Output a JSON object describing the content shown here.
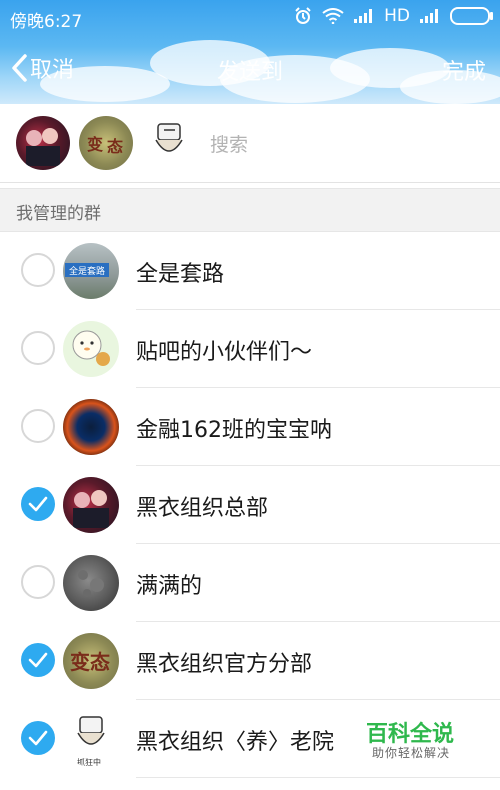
{
  "status_bar": {
    "time": "傍晚6:27",
    "network": "HD"
  },
  "nav": {
    "cancel_label": "取消",
    "title": "发送到",
    "done_label": "完成"
  },
  "selected": {
    "search_placeholder": "搜索",
    "avatars": [
      {
        "name": "黑衣组织总部",
        "icon": "anime-group-avatar"
      },
      {
        "name": "黑衣组织官方分部",
        "icon": "biantai-text-avatar"
      },
      {
        "name": "黑衣组织〈养〉老院",
        "icon": "cartoon-cat-avatar",
        "caption": "抓狂中"
      }
    ]
  },
  "section_header": "我管理的群",
  "groups": [
    {
      "name": "全是套路",
      "checked": false,
      "avatar": "street-sign-avatar",
      "avatar_text": "全是套路"
    },
    {
      "name": "贴吧的小伙伴们～",
      "checked": false,
      "avatar": "cartoon-duck-avatar"
    },
    {
      "name": "金融162班的宝宝呐",
      "checked": false,
      "avatar": "blue-fire-avatar"
    },
    {
      "name": "黑衣组织总部",
      "checked": true,
      "avatar": "anime-group-avatar"
    },
    {
      "name": "满满的",
      "checked": false,
      "avatar": "moon-avatar"
    },
    {
      "name": "黑衣组织官方分部",
      "checked": true,
      "avatar": "biantai-text-avatar",
      "avatar_text": "变态"
    },
    {
      "name": "黑衣组织〈养〉老院",
      "checked": true,
      "avatar": "cartoon-cat-avatar",
      "avatar_text": "抓狂中"
    }
  ],
  "watermark": {
    "title": "百科全说",
    "subtitle": "助你轻松解决"
  },
  "colors": {
    "accent": "#2eaaf0",
    "watermark_green": "#2fb84d"
  }
}
